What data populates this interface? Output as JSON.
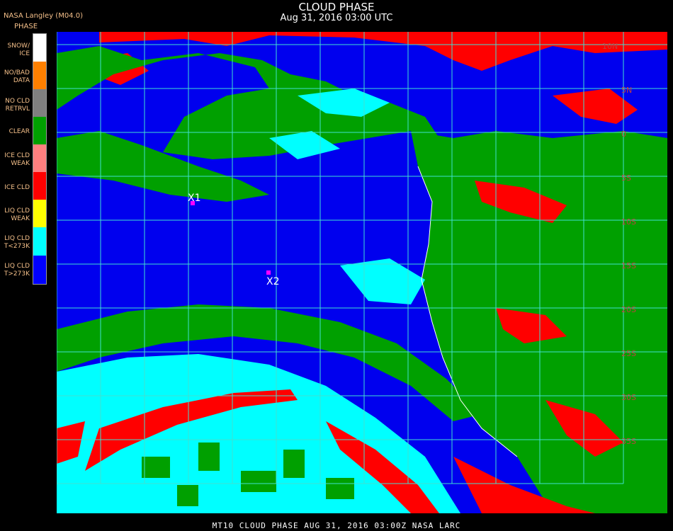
{
  "header": {
    "producer": "NASA Langley (M04.0)",
    "title": "CLOUD PHASE",
    "subtitle": "Aug 31, 2016 03:00 UTC"
  },
  "legend": {
    "heading": "PHASE",
    "items": [
      {
        "label": "SNOW/\nICE",
        "color": "#ffffff"
      },
      {
        "label": "NO/BAD\nDATA",
        "color": "#ff8000"
      },
      {
        "label": "NO CLD\nRETRVL",
        "color": "#808080"
      },
      {
        "label": "CLEAR",
        "color": "#00a000"
      },
      {
        "label": "ICE CLD\nWEAK",
        "color": "#ff8080"
      },
      {
        "label": "ICE CLD",
        "color": "#ff0000"
      },
      {
        "label": "LIQ CLD\nWEAK",
        "color": "#ffff00"
      },
      {
        "label": "LIQ CLD\nT<273K",
        "color": "#00ffff"
      },
      {
        "label": "LIQ CLD\nT>273K",
        "color": "#0000ff"
      }
    ]
  },
  "map": {
    "markers": [
      {
        "label": "X1"
      },
      {
        "label": "X2"
      }
    ],
    "lat_labels": [
      "10N",
      "5N",
      "0",
      "5S",
      "10S",
      "15S",
      "20S",
      "25S",
      "30S",
      "35S"
    ],
    "colors": {
      "ocean": "#0000ee",
      "land": "#00a000",
      "ice": "#ff0000",
      "liq_cold": "#00ffff",
      "grid": "#40e0d0",
      "marker": "#ff00ff",
      "lat_label": "#c04040"
    }
  },
  "footer": {
    "text": "MT10   CLOUD PHASE   AUG 31, 2016 03:00Z   NASA LARC"
  }
}
